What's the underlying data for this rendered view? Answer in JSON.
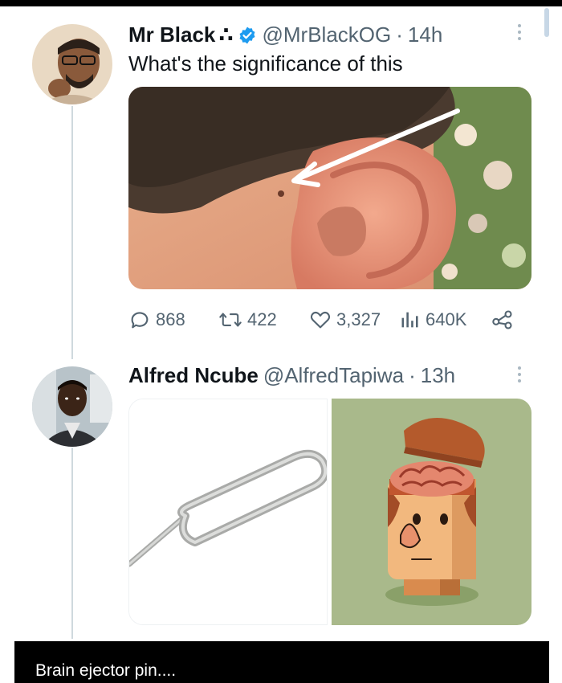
{
  "tweet1": {
    "name": "Mr Black",
    "name_glyph": "∴",
    "handle": "@MrBlackOG",
    "separator": "·",
    "time": "14h",
    "text": "What's the significance of this",
    "stats": {
      "replies": "868",
      "retweets": "422",
      "likes": "3,327",
      "views": "640K"
    }
  },
  "tweet2": {
    "name": "Alfred Ncube",
    "handle": "@AlfredTapiwa",
    "separator": "·",
    "time": "13h"
  },
  "caption": "Brain ejector pin....",
  "colors": {
    "text": "#0f1419",
    "secondary": "#536471",
    "verified": "#1d9bf0",
    "thread_line": "#cfd9de"
  },
  "icons": [
    "reply-icon",
    "retweet-icon",
    "like-icon",
    "views-icon",
    "share-icon",
    "verified-badge-icon",
    "more-options-icon"
  ]
}
